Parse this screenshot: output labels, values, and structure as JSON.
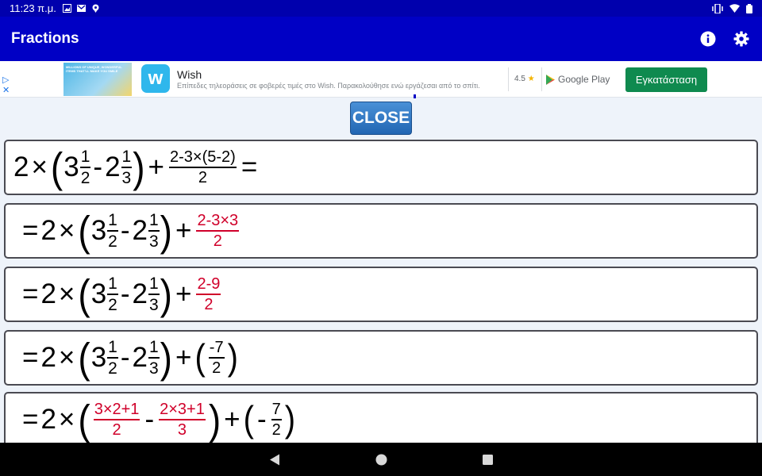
{
  "status_bar": {
    "time": "11:23 π.μ."
  },
  "app_bar": {
    "title": "Fractions"
  },
  "ad": {
    "adchoices_glyph": "▷",
    "adchoices_close": "✕",
    "banner_text": "MILLIONS OF UNIQUE, WONDERFUL ITEMS THAT'LL MAKE YOU SMILE",
    "app_logo_letter": "w",
    "app_name": "Wish",
    "description": "Επίπεδες τηλεοράσεις σε φοβερές τιμές στο Wish. Παρακολούθησε ενώ εργάζεσαι από το σπίτι.",
    "rating": "4.5",
    "store": "Google Play",
    "install_label": "Εγκατάσταση"
  },
  "close_label": "CLOSE",
  "steps": [
    {
      "id": 1,
      "lead": "2",
      "times": "×",
      "mix1_whole": "3",
      "mix1_num": "1",
      "mix1_den": "2",
      "minus": "-",
      "mix2_whole": "2",
      "mix2_num": "1",
      "mix2_den": "3",
      "plus": "+",
      "frac_num": "2-3×(5-2)",
      "frac_den": "2",
      "equals": "="
    },
    {
      "id": 2,
      "equals": "=",
      "lead": "2",
      "times": "×",
      "mix1_whole": "3",
      "mix1_num": "1",
      "mix1_den": "2",
      "minus": "-",
      "mix2_whole": "2",
      "mix2_num": "1",
      "mix2_den": "3",
      "plus": "+",
      "frac_num": "2-3×3",
      "frac_den": "2"
    },
    {
      "id": 3,
      "equals": "=",
      "lead": "2",
      "times": "×",
      "mix1_whole": "3",
      "mix1_num": "1",
      "mix1_den": "2",
      "minus": "-",
      "mix2_whole": "2",
      "mix2_num": "1",
      "mix2_den": "3",
      "plus": "+",
      "frac_num": "2-9",
      "frac_den": "2"
    },
    {
      "id": 4,
      "equals": "=",
      "lead": "2",
      "times": "×",
      "mix1_whole": "3",
      "mix1_num": "1",
      "mix1_den": "2",
      "minus": "-",
      "mix2_whole": "2",
      "mix2_num": "1",
      "mix2_den": "3",
      "plus": "+",
      "frac_num": "-7",
      "frac_den": "2"
    },
    {
      "id": 5,
      "equals": "=",
      "lead": "2",
      "times": "×",
      "f1_num": "3×2+1",
      "f1_den": "2",
      "minus": "-",
      "f2_num": "2×3+1",
      "f2_den": "3",
      "plus": "+",
      "neg": "-",
      "frac_num": "7",
      "frac_den": "2"
    }
  ],
  "colors": {
    "status_bar": "#0000ad",
    "app_bar": "#0000c5",
    "highlight": "#d0002a",
    "install": "#0f8a4f",
    "close_button": "#2e77c4"
  }
}
